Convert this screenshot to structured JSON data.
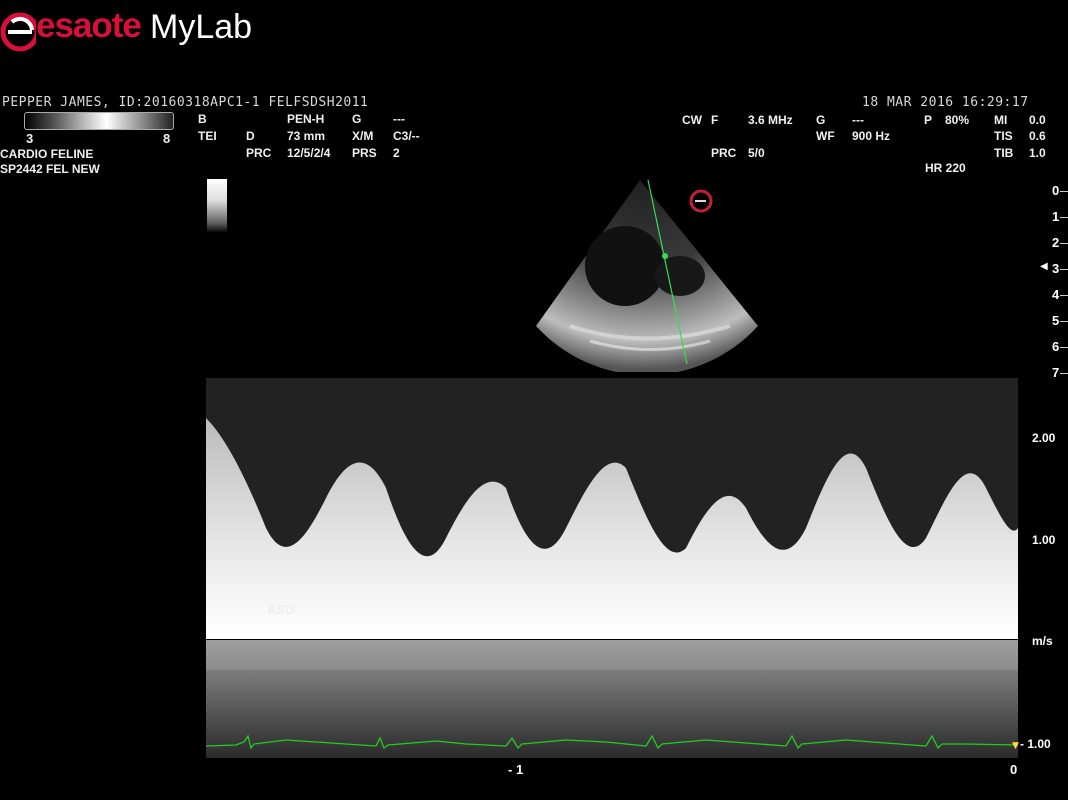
{
  "logo": {
    "brand": "esaote",
    "product": "MyLab",
    "brand_color": "#d6103a"
  },
  "patient": {
    "line": "PEPPER JAMES, ID:20160318APC1-1  FELFSDSH2011"
  },
  "datetime": {
    "line": "18  MAR  2016 16:29:17"
  },
  "gray_scale": {
    "min": "3",
    "max": "8"
  },
  "preset": {
    "line1": "CARDIO FELINE",
    "line2": "SP2442  FEL NEW"
  },
  "bmode": {
    "mode": "B",
    "tei": "TEI",
    "d": "D",
    "prc": "PRC",
    "probe": "PEN-H",
    "depth": "73 mm",
    "prc_val": "12/5/2/4",
    "g": "G",
    "xm": "X/M",
    "prs": "PRS",
    "g_val": "---",
    "xm_val": "C3/--",
    "prs_val": "2"
  },
  "cw": {
    "mode": "CW",
    "f": "F",
    "freq": "3.6 MHz",
    "g": "G",
    "g_val": "---",
    "wf": "WF",
    "wf_val": "900 Hz",
    "prc": "PRC",
    "prc_val": "5/0"
  },
  "output": {
    "p": "P",
    "p_val": "80%",
    "mi": "MI",
    "mi_val": "0.0",
    "tis": "TIS",
    "tis_val": "0.6",
    "tib": "TIB",
    "tib_val": "1.0"
  },
  "hr": "HR 220",
  "depth_scale": [
    "0",
    "1",
    "2",
    "3",
    "4",
    "5",
    "6",
    "7"
  ],
  "velocity_scale": {
    "v2": "2.00",
    "v1": "1.00",
    "unit": "m/s",
    "vneg": "- 1.00"
  },
  "time_scale": {
    "t1": "- 1",
    "t0": "0"
  },
  "annotation": "ASD",
  "colors": {
    "ecg": "#22cc22",
    "cursor": "#33dd55"
  }
}
